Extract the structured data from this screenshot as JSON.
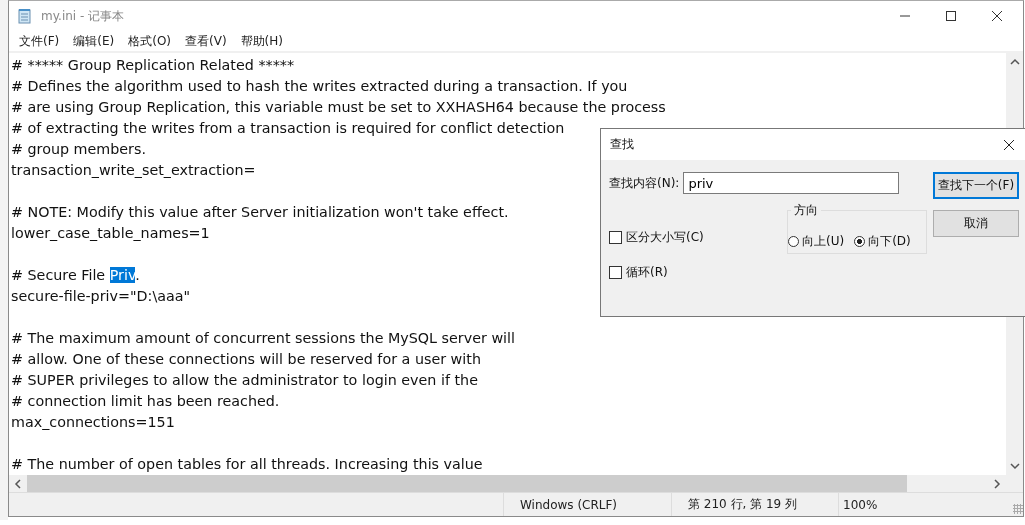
{
  "window": {
    "title": "my.ini - 记事本"
  },
  "menu": [
    {
      "label": "文件(F)"
    },
    {
      "label": "编辑(E)"
    },
    {
      "label": "格式(O)"
    },
    {
      "label": "查看(V)"
    },
    {
      "label": "帮助(H)"
    }
  ],
  "editor": {
    "lines": [
      {
        "kind": "text",
        "parts": [
          {
            "text": "# ***** Group Replication Related *****",
            "selected": false
          }
        ]
      },
      {
        "kind": "text",
        "parts": [
          {
            "text": "# Defines the algorithm used to hash the writes extracted during a transaction. If you",
            "selected": false
          }
        ]
      },
      {
        "kind": "text",
        "parts": [
          {
            "text": "# are using Group Replication, this variable must be set to XXHASH64 because the process",
            "selected": false
          }
        ]
      },
      {
        "kind": "text",
        "parts": [
          {
            "text": "# of extracting the writes from a transaction is required for conflict detection",
            "selected": false
          }
        ]
      },
      {
        "kind": "text",
        "parts": [
          {
            "text": "# group members.",
            "selected": false
          }
        ]
      },
      {
        "kind": "text",
        "parts": [
          {
            "text": "transaction_write_set_extraction=",
            "selected": false
          }
        ]
      },
      {
        "kind": "blank"
      },
      {
        "kind": "text",
        "parts": [
          {
            "text": "# NOTE: Modify this value after Server initialization won't take effect.",
            "selected": false
          }
        ]
      },
      {
        "kind": "text",
        "parts": [
          {
            "text": "lower_case_table_names=1",
            "selected": false
          }
        ]
      },
      {
        "kind": "blank"
      },
      {
        "kind": "text",
        "parts": [
          {
            "text": "# Secure File ",
            "selected": false
          },
          {
            "text": "Priv",
            "selected": true
          },
          {
            "text": ".",
            "selected": false
          }
        ]
      },
      {
        "kind": "text",
        "parts": [
          {
            "text": "secure-file-priv=\"D:\\aaa\"",
            "selected": false
          }
        ]
      },
      {
        "kind": "blank"
      },
      {
        "kind": "text",
        "parts": [
          {
            "text": "# The maximum amount of concurrent sessions the MySQL server will",
            "selected": false
          }
        ]
      },
      {
        "kind": "text",
        "parts": [
          {
            "text": "# allow. One of these connections will be reserved for a user with",
            "selected": false
          }
        ]
      },
      {
        "kind": "text",
        "parts": [
          {
            "text": "# SUPER privileges to allow the administrator to login even if the",
            "selected": false
          }
        ]
      },
      {
        "kind": "text",
        "parts": [
          {
            "text": "# connection limit has been reached.",
            "selected": false
          }
        ]
      },
      {
        "kind": "text",
        "parts": [
          {
            "text": "max_connections=151",
            "selected": false
          }
        ]
      },
      {
        "kind": "blank"
      },
      {
        "kind": "text",
        "parts": [
          {
            "text": "# The number of open tables for all threads. Increasing this value",
            "selected": false
          }
        ]
      }
    ]
  },
  "status_bar": [
    {
      "text": "Windows (CRLF)"
    },
    {
      "text": "第 210 行, 第 19 列"
    },
    {
      "text": "100%"
    }
  ],
  "find_dialog": {
    "title": "查找",
    "find_label": "查找内容(N):",
    "find_value": "priv",
    "buttons": [
      {
        "label": "查找下一个(F)",
        "default": true
      },
      {
        "label": "取消",
        "default": false
      }
    ],
    "direction": {
      "label": "方向",
      "options": [
        {
          "label": "向上(U)",
          "selected": false
        },
        {
          "label": "向下(D)",
          "selected": true
        }
      ]
    },
    "checkboxes": [
      {
        "label": "区分大小写(C)",
        "checked": false
      },
      {
        "label": "循环(R)",
        "checked": false
      }
    ]
  }
}
